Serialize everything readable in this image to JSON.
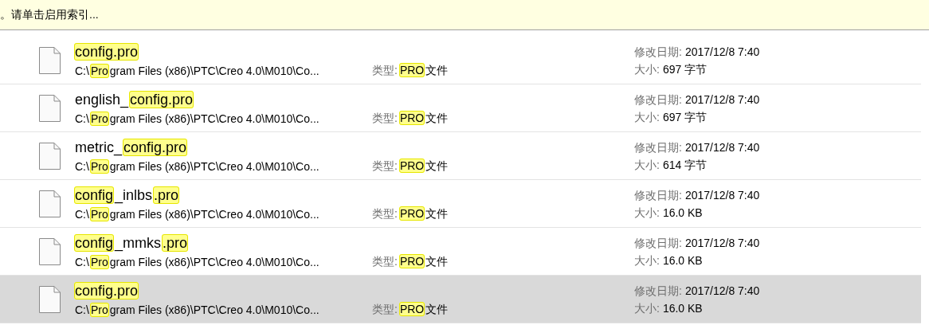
{
  "info_bar": {
    "text": "。请单击启用索引..."
  },
  "results": [
    {
      "selected": false,
      "name": [
        {
          "text": "config.pro",
          "highlight": true
        }
      ],
      "path": [
        {
          "text": "C:\\",
          "highlight": false
        },
        {
          "text": "Pro",
          "highlight": true
        },
        {
          "text": "gram Files (x86)\\PTC\\Creo 4.0\\M010\\Co...",
          "highlight": false
        }
      ],
      "type_label": "类型:",
      "type": [
        {
          "text": "PRO",
          "highlight": true
        },
        {
          "text": "文件",
          "highlight": false
        }
      ],
      "date_label": "修改日期:",
      "date": "2017/12/8 7:40",
      "size_label": "大小:",
      "size": "697 字节"
    },
    {
      "selected": false,
      "name": [
        {
          "text": "english_",
          "highlight": false
        },
        {
          "text": "config.pro",
          "highlight": true
        }
      ],
      "path": [
        {
          "text": "C:\\",
          "highlight": false
        },
        {
          "text": "Pro",
          "highlight": true
        },
        {
          "text": "gram Files (x86)\\PTC\\Creo 4.0\\M010\\Co...",
          "highlight": false
        }
      ],
      "type_label": "类型:",
      "type": [
        {
          "text": "PRO",
          "highlight": true
        },
        {
          "text": "文件",
          "highlight": false
        }
      ],
      "date_label": "修改日期:",
      "date": "2017/12/8 7:40",
      "size_label": "大小:",
      "size": "697 字节"
    },
    {
      "selected": false,
      "name": [
        {
          "text": "metric_",
          "highlight": false
        },
        {
          "text": "config.pro",
          "highlight": true
        }
      ],
      "path": [
        {
          "text": "C:\\",
          "highlight": false
        },
        {
          "text": "Pro",
          "highlight": true
        },
        {
          "text": "gram Files (x86)\\PTC\\Creo 4.0\\M010\\Co...",
          "highlight": false
        }
      ],
      "type_label": "类型:",
      "type": [
        {
          "text": "PRO",
          "highlight": true
        },
        {
          "text": "文件",
          "highlight": false
        }
      ],
      "date_label": "修改日期:",
      "date": "2017/12/8 7:40",
      "size_label": "大小:",
      "size": "614 字节"
    },
    {
      "selected": false,
      "name": [
        {
          "text": "config",
          "highlight": true
        },
        {
          "text": "_inlbs",
          "highlight": false
        },
        {
          "text": ".pro",
          "highlight": true
        }
      ],
      "path": [
        {
          "text": "C:\\",
          "highlight": false
        },
        {
          "text": "Pro",
          "highlight": true
        },
        {
          "text": "gram Files (x86)\\PTC\\Creo 4.0\\M010\\Co...",
          "highlight": false
        }
      ],
      "type_label": "类型:",
      "type": [
        {
          "text": "PRO",
          "highlight": true
        },
        {
          "text": "文件",
          "highlight": false
        }
      ],
      "date_label": "修改日期:",
      "date": "2017/12/8 7:40",
      "size_label": "大小:",
      "size": "16.0 KB"
    },
    {
      "selected": false,
      "name": [
        {
          "text": "config",
          "highlight": true
        },
        {
          "text": "_mmks",
          "highlight": false
        },
        {
          "text": ".pro",
          "highlight": true
        }
      ],
      "path": [
        {
          "text": "C:\\",
          "highlight": false
        },
        {
          "text": "Pro",
          "highlight": true
        },
        {
          "text": "gram Files (x86)\\PTC\\Creo 4.0\\M010\\Co...",
          "highlight": false
        }
      ],
      "type_label": "类型:",
      "type": [
        {
          "text": "PRO",
          "highlight": true
        },
        {
          "text": "文件",
          "highlight": false
        }
      ],
      "date_label": "修改日期:",
      "date": "2017/12/8 7:40",
      "size_label": "大小:",
      "size": "16.0 KB"
    },
    {
      "selected": true,
      "name": [
        {
          "text": "config.pro",
          "highlight": true
        }
      ],
      "path": [
        {
          "text": "C:\\",
          "highlight": false
        },
        {
          "text": "Pro",
          "highlight": true
        },
        {
          "text": "gram Files (x86)\\PTC\\Creo 4.0\\M010\\Co...",
          "highlight": false
        }
      ],
      "type_label": "类型:",
      "type": [
        {
          "text": "PRO",
          "highlight": true
        },
        {
          "text": "文件",
          "highlight": false
        }
      ],
      "date_label": "修改日期:",
      "date": "2017/12/8 7:40",
      "size_label": "大小:",
      "size": "16.0 KB"
    }
  ]
}
